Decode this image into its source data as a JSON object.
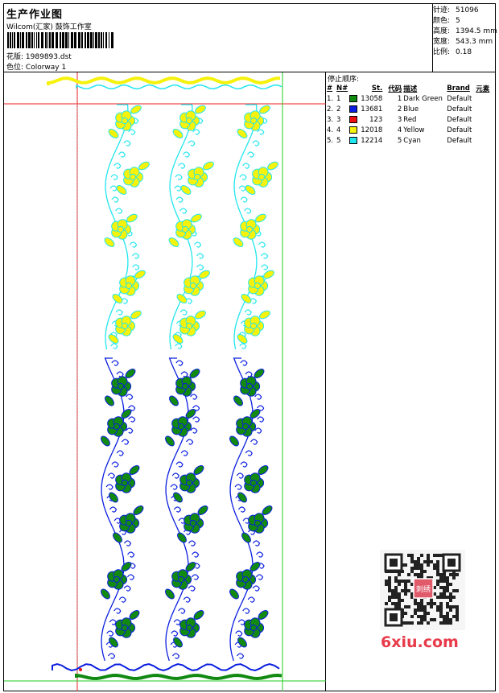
{
  "header": {
    "title": "生产作业图",
    "company": "Wilcom(汇家) 鼓饰工作室",
    "design_label": "花版:",
    "design_value": "1989893.dst",
    "colorway_label": "色位:",
    "colorway_value": "Colorway 1"
  },
  "stats": [
    {
      "label": "针迹:",
      "value": "51096"
    },
    {
      "label": "颜色:",
      "value": "5"
    },
    {
      "label": "高度:",
      "value": "1394.5 mm"
    },
    {
      "label": "宽度:",
      "value": "543.3 mm"
    },
    {
      "label": "比例:",
      "value": "0.18"
    }
  ],
  "stop_sequence": {
    "title": "停止顺序:",
    "headers": [
      "#",
      "N#",
      "St.",
      "代码",
      "描述",
      "Brand",
      "元素"
    ],
    "rows": [
      {
        "no": "1.",
        "n": "1",
        "color": "#128a12",
        "st": "13058",
        "code": "1",
        "desc": "Dark Green",
        "brand": "Default"
      },
      {
        "no": "2.",
        "n": "2",
        "color": "#0a1ee0",
        "st": "13681",
        "code": "2",
        "desc": "Blue",
        "brand": "Default"
      },
      {
        "no": "3.",
        "n": "3",
        "color": "#ee1010",
        "st": "123",
        "code": "3",
        "desc": "Red",
        "brand": "Default"
      },
      {
        "no": "4.",
        "n": "4",
        "color": "#f6f20c",
        "st": "12018",
        "code": "4",
        "desc": "Yellow",
        "brand": "Default"
      },
      {
        "no": "5.",
        "n": "5",
        "color": "#22e6ee",
        "st": "12214",
        "code": "5",
        "desc": "Cyan",
        "brand": "Default"
      }
    ]
  },
  "colors": {
    "dark_green": "#128a12",
    "blue": "#0a1ee0",
    "red": "#ee1010",
    "yellow": "#f6f20c",
    "cyan": "#22e6ee",
    "guide_green": "#22cc22",
    "guide_red": "#ee2020",
    "watermark": "#e83a4a"
  },
  "watermark": {
    "text": "6xiu.com",
    "qr_label": "刺绣"
  }
}
